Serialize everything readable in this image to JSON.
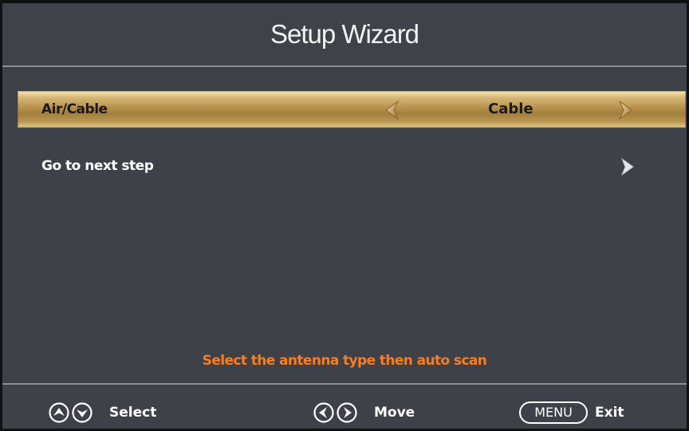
{
  "header": {
    "title": "Setup Wizard"
  },
  "menu": {
    "rows": [
      {
        "label": "Air/Cable",
        "value": "Cable",
        "selected": true
      },
      {
        "label": "Go to next step",
        "selected": false
      }
    ]
  },
  "hint": "Select the antenna type then auto scan",
  "footer": {
    "select_label": "Select",
    "move_label": "Move",
    "menu_key": "MENU",
    "exit_label": "Exit"
  },
  "colors": {
    "background": "#3e4148",
    "highlight": "#b8924c",
    "hint_text": "#ff7d1f",
    "text": "#ffffff"
  },
  "icons": [
    "up-arrow-icon",
    "down-arrow-icon",
    "left-arrow-icon",
    "right-arrow-icon",
    "chevron-left-icon",
    "chevron-right-icon"
  ]
}
